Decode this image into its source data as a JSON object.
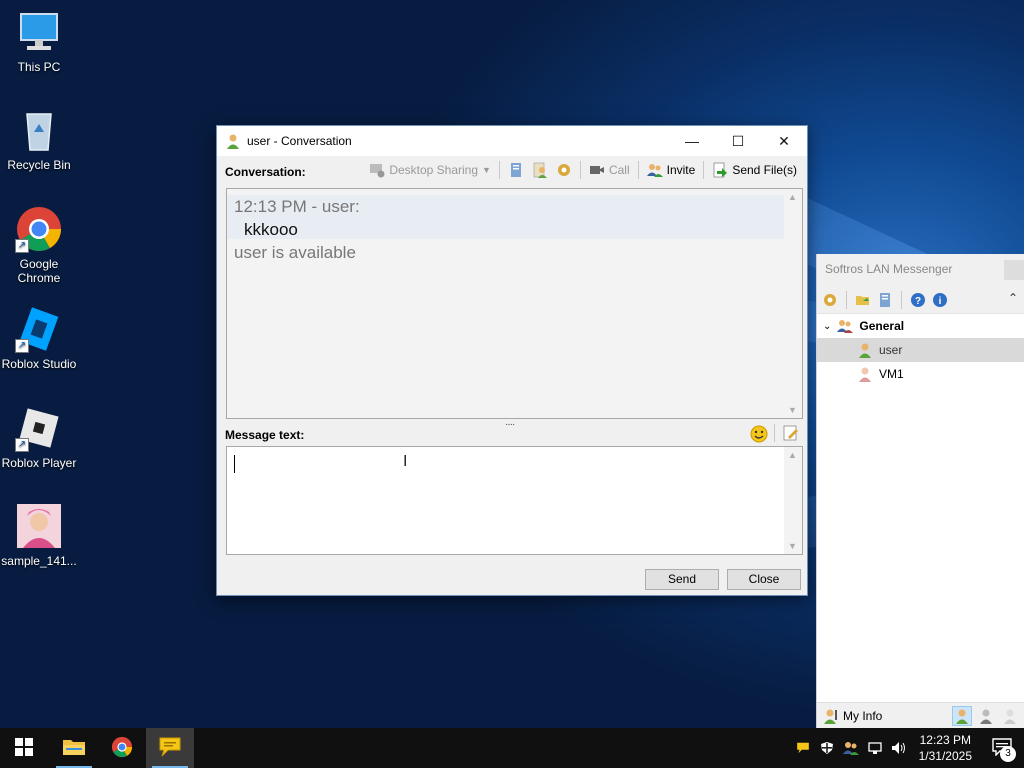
{
  "desktop": {
    "icons": [
      {
        "label": "This PC",
        "icon": "monitor-icon"
      },
      {
        "label": "Recycle Bin",
        "icon": "recycle-bin-icon"
      },
      {
        "label": "Google Chrome",
        "icon": "chrome-icon"
      },
      {
        "label": "Roblox Studio",
        "icon": "roblox-studio-icon"
      },
      {
        "label": "Roblox Player",
        "icon": "roblox-player-icon"
      },
      {
        "label": "sample_141...",
        "icon": "image-file-icon"
      }
    ]
  },
  "conversation_window": {
    "title": "user - Conversation",
    "conversation_label": "Conversation:",
    "toolbar": {
      "desktop_sharing": "Desktop Sharing",
      "call": "Call",
      "invite": "Invite",
      "send_files": "Send File(s)"
    },
    "messages": {
      "header": "12:13 PM - user:",
      "text": "kkkooo",
      "status": "user is available"
    },
    "message_label": "Message text:",
    "message_value": "",
    "send_label": "Send",
    "close_label": "Close"
  },
  "lan_messenger": {
    "title": "Softros LAN Messenger",
    "group": "General",
    "users": [
      {
        "name": "user",
        "status": "online",
        "selected": true
      },
      {
        "name": "VM1",
        "status": "offline",
        "selected": false
      }
    ],
    "my_info": "My Info"
  },
  "taskbar": {
    "time": "12:23 PM",
    "date": "1/31/2025",
    "notification_count": "3"
  },
  "colors": {
    "titlebar_bg": "#ffffff",
    "selected_row": "#d9d9d9",
    "message_highlight": "#e8edf3",
    "taskbar_bg": "#101010",
    "active_taskbar_underline": "#76b9ed"
  }
}
